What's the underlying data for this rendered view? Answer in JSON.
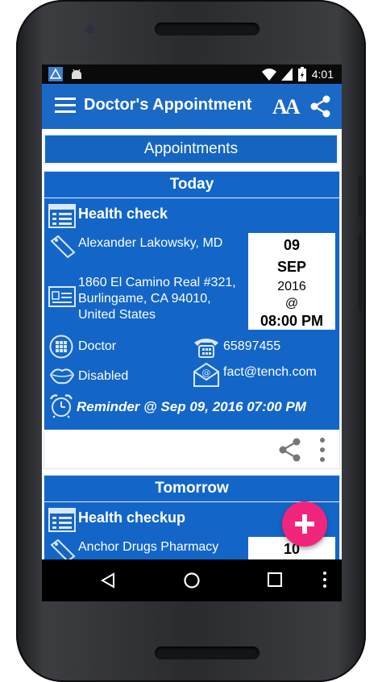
{
  "status_bar": {
    "time": "4:01",
    "icons": [
      "app-logo-icon",
      "android-icon",
      "wifi-icon",
      "signal-icon",
      "battery-icon"
    ]
  },
  "app_bar": {
    "title": "Doctor's Appointment",
    "font_button_label": "AA",
    "icons": [
      "menu-icon",
      "font-size-icon",
      "share-icon"
    ]
  },
  "banner": {
    "label": "Appointments"
  },
  "cards": [
    {
      "header": "Today",
      "title": "Health check",
      "person": "Alexander Lakowsky, MD",
      "address": [
        "1860 El Camino Real #321,",
        "Burlingame, CA 94010,",
        "United States"
      ],
      "date": {
        "day": "09",
        "month": "SEP",
        "year": "2016",
        "at": "@",
        "time": "08:00 PM"
      },
      "category": "Doctor",
      "phone": "65897455",
      "accessibility": "Disabled",
      "email": "fact@tench.com",
      "reminder": "Reminder @ Sep 09, 2016 07:00 PM"
    },
    {
      "header": "Tomorrow",
      "title": "Health checkup",
      "person": "Anchor Drugs Pharmacy",
      "date": {
        "day": "10"
      }
    }
  ],
  "colors": {
    "app_bar": "#1b69c6",
    "card": "#1366c8",
    "fab": "#f2257d",
    "status_bar": "#0a0a0a"
  },
  "fab": {
    "icon": "plus-icon"
  },
  "nav_bar": {
    "icons": [
      "back-icon",
      "home-icon",
      "recents-icon",
      "more-icon"
    ]
  }
}
